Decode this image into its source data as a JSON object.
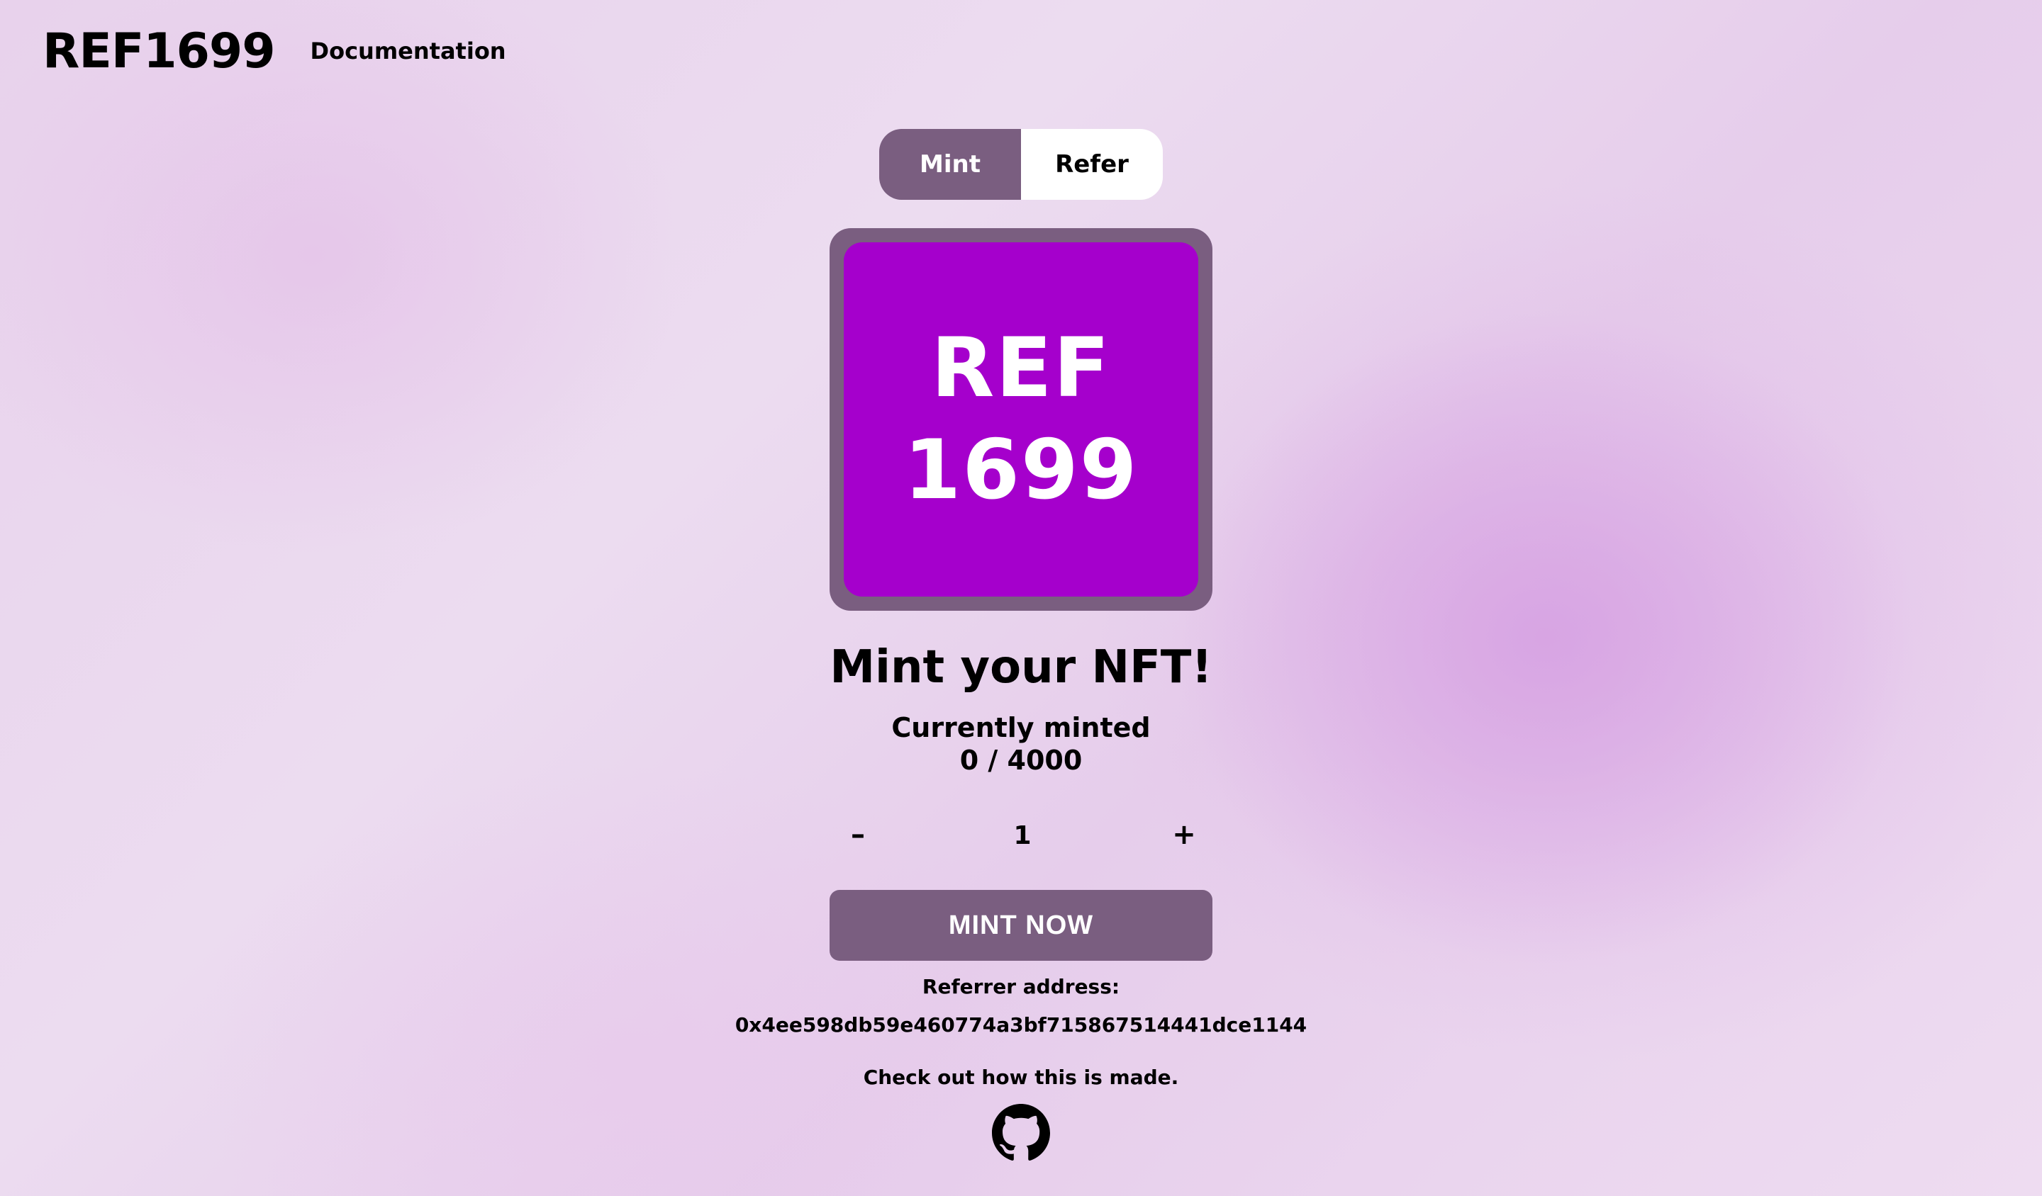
{
  "header": {
    "logo": "REF1699",
    "nav_documentation": "Documentation"
  },
  "tabs": [
    {
      "label": "Mint",
      "active": true
    },
    {
      "label": "Refer",
      "active": false
    }
  ],
  "nft": {
    "line1": "REF",
    "line2": "1699"
  },
  "main": {
    "title": "Mint your NFT!",
    "minted_label": "Currently minted",
    "minted_count": "0 / 4000",
    "stepper": {
      "minus": "–",
      "value": "1",
      "plus": "+"
    },
    "mint_button": "MINT NOW",
    "referrer_label": "Referrer address:",
    "referrer_address": "0x4ee598db59e460774a3bf715867514441dce1144",
    "made_text": "Check out how this is made."
  },
  "icons": {
    "github": "github-icon"
  },
  "colors": {
    "accent": "#7a5e80",
    "nft_bg": "#a500cc",
    "text": "#000000",
    "on_accent": "#ffffff"
  }
}
